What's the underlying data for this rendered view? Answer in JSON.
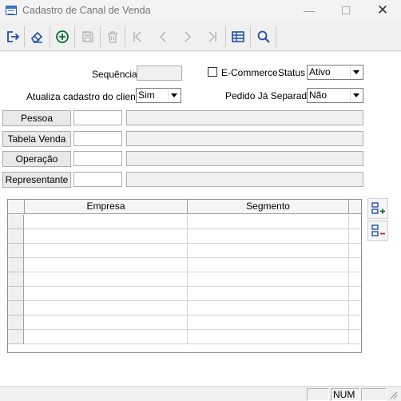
{
  "window": {
    "title": "Cadastro de Canal de Venda",
    "minimize_glyph": "—",
    "maximize_glyph": "☐",
    "close_glyph": "✕"
  },
  "toolbar": {
    "icons": [
      "exit-icon",
      "eraser-icon",
      "add-circle-icon",
      "save-icon",
      "trash-icon",
      "first-record-icon",
      "previous-record-icon",
      "next-record-icon",
      "last-record-icon",
      "table-view-icon",
      "search-icon"
    ],
    "enabled_color": "#0b6e2e",
    "accent_blue": "#1e4fa8",
    "disabled_color": "#b9b9b9"
  },
  "form": {
    "sequencia_label": "Sequência",
    "sequencia_value": "",
    "ecommerce_label": "E-Commerce",
    "ecommerce_checked": false,
    "status_label": "Status",
    "status_value": "Ativo",
    "atualiza_label": "Atualiza cadastro do cliente",
    "atualiza_value": "Sim",
    "pedido_label": "Pedido Já Separado",
    "pedido_value": "Não",
    "pessoa_button": "Pessoa",
    "pessoa_code": "",
    "pessoa_desc": "",
    "tabela_button": "Tabela Venda",
    "tabela_code": "",
    "tabela_desc": "",
    "operacao_button": "Operação",
    "operacao_code": "",
    "operacao_desc": "",
    "representante_button": "Representante",
    "representante_code": "",
    "representante_desc": ""
  },
  "grid": {
    "columns": [
      "Empresa",
      "Segmento"
    ],
    "empty_rows": 9,
    "side_buttons": [
      "add-row-icon",
      "remove-row-icon"
    ]
  },
  "statusbar": {
    "panel_1": "",
    "num": "NUM",
    "panel_3": ""
  }
}
